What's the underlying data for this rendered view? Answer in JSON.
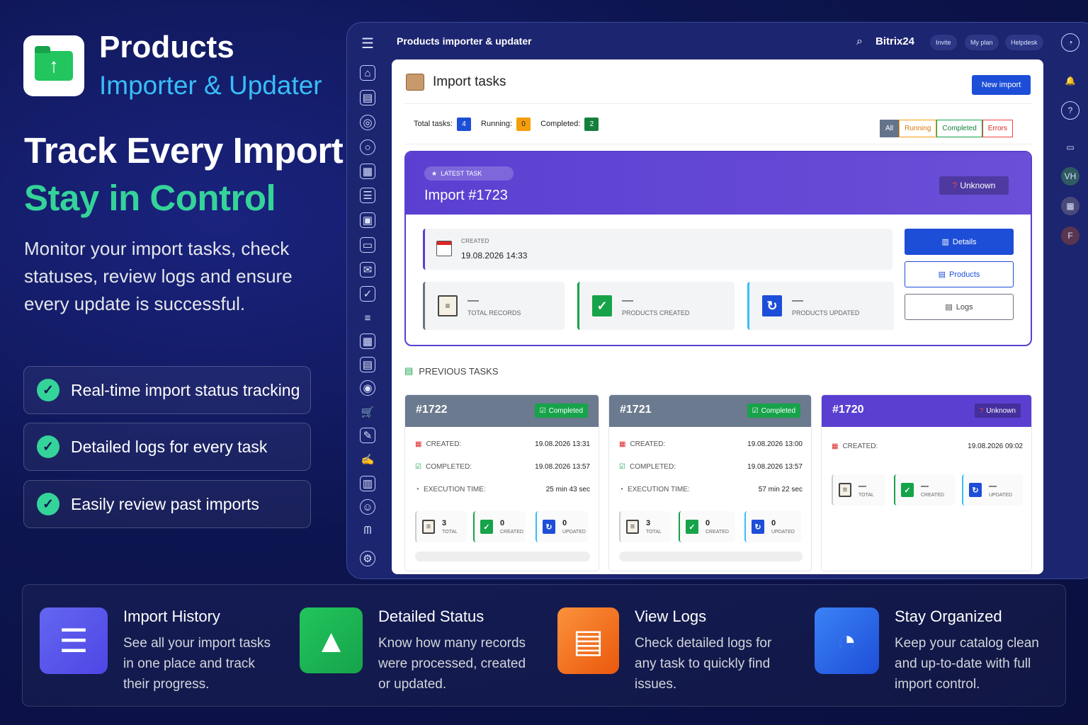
{
  "brand": {
    "title": "Products",
    "subtitle": "Importer & Updater"
  },
  "hero": {
    "line1": "Track Every Import",
    "line2": "Stay in Control",
    "description": "Monitor your import tasks, check statuses, review logs and ensure every update is successful."
  },
  "features": [
    "Real-time import status tracking",
    "Detailed logs for every task",
    "Easily review past imports"
  ],
  "app": {
    "topbar_title": "Products importer & updater",
    "bitrix": "Bitrix24",
    "top_buttons": [
      "Invite",
      "My plan",
      "Helpdesk"
    ],
    "avatars": [
      "VH",
      "F"
    ],
    "page_title": "Import tasks",
    "new_import": "New import",
    "stats": {
      "total_label": "Total tasks:",
      "total": "4",
      "running_label": "Running:",
      "running": "0",
      "completed_label": "Completed:",
      "completed": "2"
    },
    "filters": [
      "All",
      "Running",
      "Completed",
      "Errors"
    ],
    "latest": {
      "tag": "LATEST TASK",
      "name": "Import #1723",
      "status": "Unknown",
      "created_label": "CREATED",
      "created": "19.08.2026 14:33",
      "tiles": [
        {
          "value": "—",
          "label": "TOTAL RECORDS"
        },
        {
          "value": "—",
          "label": "PRODUCTS CREATED"
        },
        {
          "value": "—",
          "label": "PRODUCTS UPDATED"
        }
      ],
      "buttons": [
        "Details",
        "Products",
        "Logs"
      ]
    },
    "prev_title": "PREVIOUS TASKS",
    "cards": [
      {
        "id": "#1722",
        "status": "Completed",
        "created_label": "CREATED:",
        "created": "19.08.2026 13:31",
        "completed_label": "COMPLETED:",
        "completed": "19.08.2026 13:57",
        "exec_label": "EXECUTION TIME:",
        "exec": "25 min 43 sec",
        "total": "3",
        "total_label": "TOTAL",
        "created_n": "0",
        "created_n_label": "CREATED",
        "updated_n": "0",
        "updated_n_label": "UPDATED"
      },
      {
        "id": "#1721",
        "status": "Completed",
        "created_label": "CREATED:",
        "created": "19.08.2026 13:00",
        "completed_label": "COMPLETED:",
        "completed": "19.08.2026 13:57",
        "exec_label": "EXECUTION TIME:",
        "exec": "57 min 22 sec",
        "total": "3",
        "total_label": "TOTAL",
        "created_n": "0",
        "created_n_label": "CREATED",
        "updated_n": "0",
        "updated_n_label": "UPDATED"
      },
      {
        "id": "#1720",
        "status": "Unknown",
        "created_label": "CREATED:",
        "created": "19.08.2026 09:02",
        "total": "—",
        "total_label": "TOTAL",
        "created_n": "—",
        "created_n_label": "CREATED",
        "updated_n": "—",
        "updated_n_label": "UPDATED"
      }
    ]
  },
  "bottom": [
    {
      "title": "Import History",
      "text": "See all your import tasks in one place and track their progress."
    },
    {
      "title": "Detailed Status",
      "text": "Know how many records were processed, created or updated."
    },
    {
      "title": "View Logs",
      "text": "Check detailed logs for any task to quickly find issues."
    },
    {
      "title": "Stay Organized",
      "text": "Keep your catalog clean and up-to-date with full import control."
    }
  ]
}
